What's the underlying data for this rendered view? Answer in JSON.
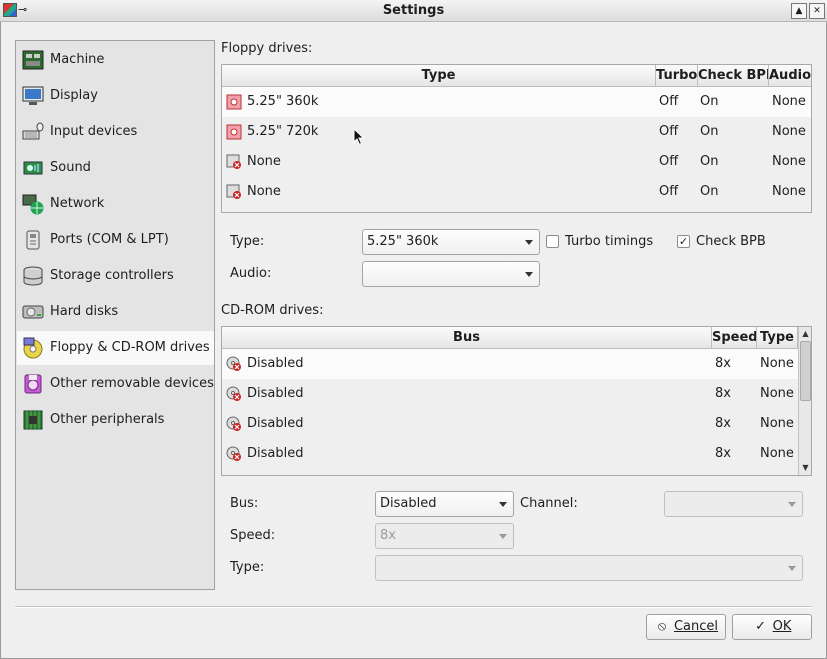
{
  "window": {
    "title": "Settings",
    "pin_glyph": "⊸",
    "buttons": [
      "▲",
      "✕"
    ]
  },
  "sidebar": {
    "items": [
      {
        "label": "Machine",
        "icon": "machine-icon"
      },
      {
        "label": "Display",
        "icon": "display-icon"
      },
      {
        "label": "Input devices",
        "icon": "input-devices-icon"
      },
      {
        "label": "Sound",
        "icon": "sound-icon"
      },
      {
        "label": "Network",
        "icon": "network-icon"
      },
      {
        "label": "Ports (COM & LPT)",
        "icon": "ports-icon"
      },
      {
        "label": "Storage controllers",
        "icon": "storage-controllers-icon"
      },
      {
        "label": "Hard disks",
        "icon": "hard-disk-icon"
      },
      {
        "label": "Floppy & CD-ROM drives",
        "icon": "floppy-cdrom-icon",
        "selected": true
      },
      {
        "label": "Other removable devices",
        "icon": "removable-devices-icon"
      },
      {
        "label": "Other peripherals",
        "icon": "peripherals-icon"
      }
    ]
  },
  "floppy": {
    "section_label": "Floppy drives:",
    "columns": [
      "Type",
      "Turbo",
      "Check BPB",
      "Audio"
    ],
    "rows": [
      {
        "type": "5.25\" 360k",
        "turbo": "Off",
        "check_bpb": "On",
        "audio": "None",
        "icon": "floppy-disk-icon",
        "selected": true
      },
      {
        "type": "5.25\" 720k",
        "turbo": "Off",
        "check_bpb": "On",
        "audio": "None",
        "icon": "floppy-disk-icon"
      },
      {
        "type": "None",
        "turbo": "Off",
        "check_bpb": "On",
        "audio": "None",
        "icon": "floppy-disabled-icon"
      },
      {
        "type": "None",
        "turbo": "Off",
        "check_bpb": "On",
        "audio": "None",
        "icon": "floppy-disabled-icon"
      }
    ],
    "type_label": "Type:",
    "type_value": "5.25\" 360k",
    "turbo_label": "Turbo timings",
    "turbo_checked": false,
    "checkbpb_label": "Check BPB",
    "checkbpb_checked": true,
    "audio_label": "Audio:",
    "audio_value": ""
  },
  "cdrom": {
    "section_label": "CD-ROM drives:",
    "columns": [
      "Bus",
      "Speed",
      "Type"
    ],
    "rows": [
      {
        "bus": "Disabled",
        "speed": "8x",
        "type": "None",
        "icon": "cdrom-disabled-icon",
        "selected": true
      },
      {
        "bus": "Disabled",
        "speed": "8x",
        "type": "None",
        "icon": "cdrom-disabled-icon"
      },
      {
        "bus": "Disabled",
        "speed": "8x",
        "type": "None",
        "icon": "cdrom-disabled-icon"
      },
      {
        "bus": "Disabled",
        "speed": "8x",
        "type": "None",
        "icon": "cdrom-disabled-icon"
      }
    ],
    "bus_label": "Bus:",
    "bus_value": "Disabled",
    "channel_label": "Channel:",
    "channel_value": "",
    "speed_label": "Speed:",
    "speed_value": "8x",
    "type_label": "Type:",
    "type_value": ""
  },
  "footer": {
    "cancel_label": "Cancel",
    "cancel_icon": "⃠",
    "ok_label": "OK",
    "ok_icon": "✓"
  },
  "colors": {
    "selection": "#fbfbfb",
    "sidebar_bg": "#e4e4e4",
    "floppy_icon": "#e85b6c",
    "disabled_x": "#cc2222"
  }
}
